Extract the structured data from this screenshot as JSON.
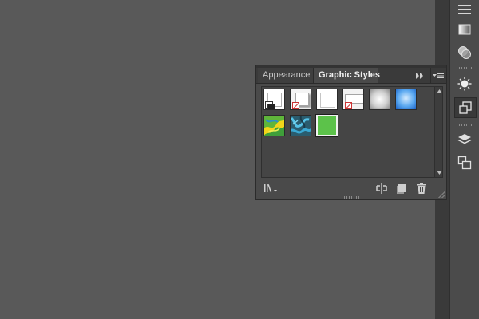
{
  "panel": {
    "tabs": [
      {
        "label": "Appearance",
        "active": false
      },
      {
        "label": "Graphic Styles",
        "active": true
      }
    ],
    "swatches": [
      {
        "name": "default-style",
        "kind": "default"
      },
      {
        "name": "basic-graphic-style",
        "kind": "drop-shadow-none"
      },
      {
        "name": "white-plain",
        "kind": "plain-white"
      },
      {
        "name": "two-box",
        "kind": "two-box-none"
      },
      {
        "name": "gray-gradient",
        "kind": "gray-gradient"
      },
      {
        "name": "blue-gradient",
        "kind": "blue-gradient"
      },
      {
        "name": "yellow-green-pattern",
        "kind": "yellow-green-pattern"
      },
      {
        "name": "blue-texture",
        "kind": "blue-texture"
      },
      {
        "name": "green-fill",
        "kind": "green-fill",
        "selected": true
      }
    ],
    "selected_swatch_color": "#5cc24a"
  },
  "icons": {
    "dock": [
      "menu-lines-icon",
      "gradient-icon",
      "transparency-icon",
      "appearance-sun-icon",
      "graphic-styles-icon",
      "layers-icon",
      "artboards-icon"
    ],
    "panel_bottom": [
      "libraries-menu-icon",
      "break-link-icon",
      "new-style-icon",
      "delete-icon"
    ],
    "panel_header": [
      "collapse-panel-icon",
      "panel-menu-icon"
    ]
  },
  "colors": {
    "canvas": "#595959",
    "panel": "#4a4a4a",
    "dock": "#4b4b4b",
    "green_style": "#5cc24a"
  }
}
